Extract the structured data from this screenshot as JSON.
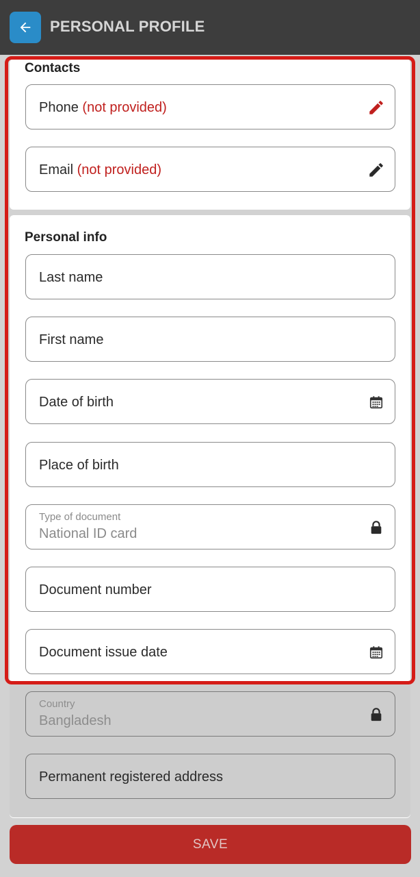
{
  "header": {
    "title": "PERSONAL PROFILE",
    "back_icon": "arrow-left-icon"
  },
  "contacts": {
    "section_label": "Contacts",
    "phone": {
      "label": "Phone",
      "status": "(not provided)",
      "icon": "pencil-icon",
      "icon_color": "#c0201e"
    },
    "email": {
      "label": "Email",
      "status": "(not provided)",
      "icon": "pencil-icon",
      "icon_color": "#2a2a2a"
    }
  },
  "personal_info": {
    "section_label": "Personal info",
    "last_name": "Last name",
    "first_name": "First name",
    "date_of_birth": "Date of birth",
    "place_of_birth": "Place of birth",
    "document_type": {
      "label": "Type of document",
      "value": "National ID card"
    },
    "document_number": "Document number",
    "document_issue_date": "Document issue date",
    "country": {
      "label": "Country",
      "value": "Bangladesh"
    },
    "permanent_address": "Permanent registered address"
  },
  "save_label": "SAVE",
  "colors": {
    "accent_blue": "#2a8cc8",
    "not_provided_red": "#c0201e",
    "save_red": "#b92b27",
    "highlight_red": "#d51c17"
  }
}
